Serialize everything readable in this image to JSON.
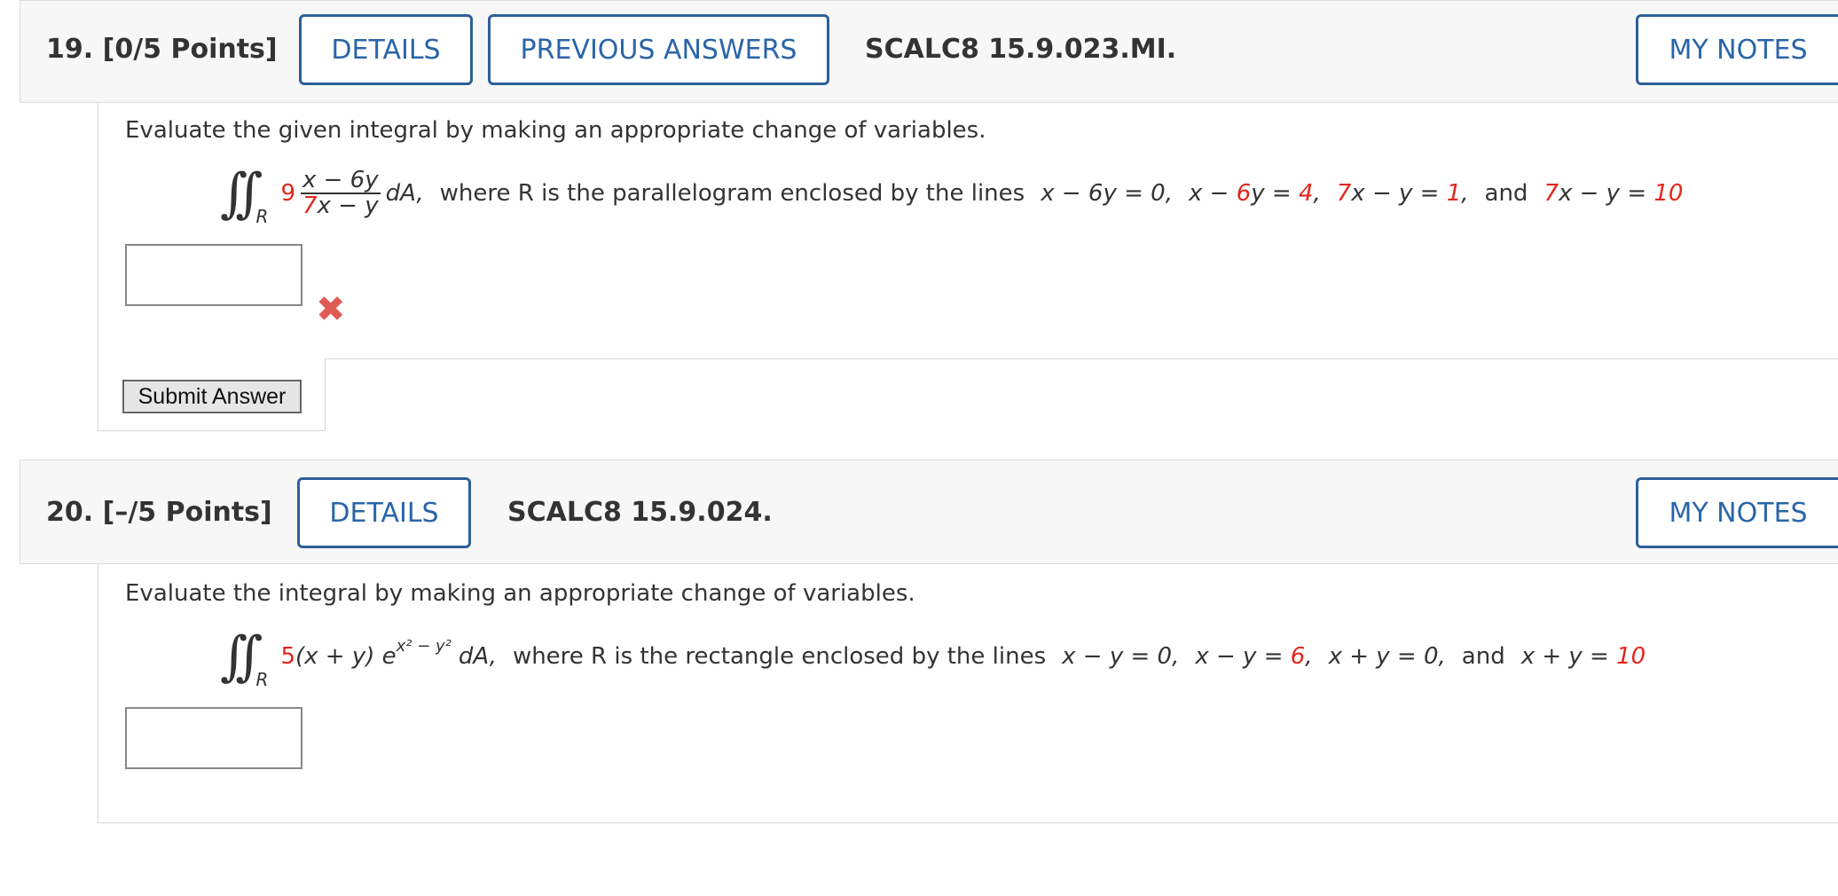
{
  "q19": {
    "number": "19.",
    "points": "[0/5 Points]",
    "details_label": "DETAILS",
    "prev_answers_label": "PREVIOUS ANSWERS",
    "code": "SCALC8 15.9.023.MI.",
    "notes_label": "MY NOTES",
    "prompt": "Evaluate the given integral by making an appropriate change of variables.",
    "region_sub": "R",
    "coef": "9",
    "frac_num": "x − 6y",
    "frac_den_coef": "7",
    "frac_den_rest": "x − y",
    "dA": "dA,",
    "where_text": "where R is the parallelogram enclosed by the lines",
    "line1": "x − 6y = 0,",
    "line2_a": "x − ",
    "line2_b": "6",
    "line2_c": "y = ",
    "line2_d": "4",
    "line3_a": "7",
    "line3_b": "x − y = ",
    "line3_c": "1",
    "and_text": "and",
    "line4_a": "7",
    "line4_b": "x − y = ",
    "line4_c": "10",
    "answer_value": "",
    "status_icon": "x-mark-icon",
    "submit_label": "Submit Answer"
  },
  "q20": {
    "number": "20.",
    "points": "[–/5 Points]",
    "details_label": "DETAILS",
    "code": "SCALC8 15.9.024.",
    "notes_label": "MY NOTES",
    "prompt": "Evaluate the integral by making an appropriate change of variables.",
    "region_sub": "R",
    "coef": "5",
    "integrand": "(x + y) e",
    "exponent": "x² − y²",
    "dA": "dA,",
    "where_text": "where R is the rectangle enclosed by the lines",
    "line1": "x − y = 0,",
    "line2_a": "x − y = ",
    "line2_b": "6",
    "line3": "x + y = 0,",
    "and_text": "and",
    "line4_a": "x + y = ",
    "line4_b": "10",
    "answer_value": ""
  },
  "colors": {
    "accent": "#2a65a8",
    "highlight": "#e3261c",
    "error": "#e05a56"
  }
}
